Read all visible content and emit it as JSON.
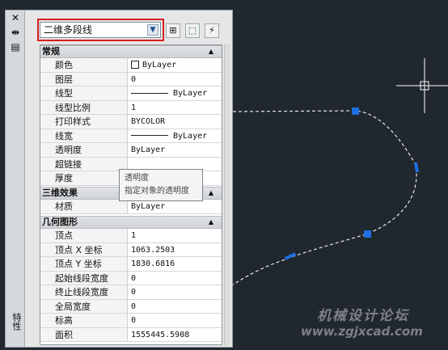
{
  "object_selector": {
    "value": "二维多段线",
    "arrow_icon": "chevron-down-icon"
  },
  "titlebar": {
    "close_glyph": "✕",
    "autohide_glyph": "⇹",
    "menu_glyph": "▤",
    "vertical_title": "特性"
  },
  "toolbar": [
    {
      "name": "toggle-pickadd-button",
      "icon": "pickadd-icon",
      "glyph": "⊞"
    },
    {
      "name": "select-objects-button",
      "icon": "select-objects-icon",
      "glyph": "⬚"
    },
    {
      "name": "quick-select-button",
      "icon": "quick-select-icon",
      "glyph": "⚡"
    }
  ],
  "sections": {
    "general": "常规",
    "3d_effects": "三维效果",
    "geometry": "几何图形"
  },
  "general_rows": [
    {
      "label": "颜色",
      "value": "ByLayer",
      "kind": "color"
    },
    {
      "label": "图层",
      "value": "0"
    },
    {
      "label": "线型",
      "value": "ByLayer",
      "kind": "line"
    },
    {
      "label": "线型比例",
      "value": "1"
    },
    {
      "label": "打印样式",
      "value": "BYCOLOR"
    },
    {
      "label": "线宽",
      "value": "ByLayer",
      "kind": "line"
    },
    {
      "label": "透明度",
      "value": "ByLayer"
    },
    {
      "label": "超链接",
      "value": ""
    },
    {
      "label": "厚度",
      "value": ""
    }
  ],
  "effects_rows": [
    {
      "label": "材质",
      "value": "ByLayer"
    }
  ],
  "geometry_rows": [
    {
      "label": "顶点",
      "value": "1"
    },
    {
      "label": "顶点 X 坐标",
      "value": "1063.2503"
    },
    {
      "label": "顶点 Y 坐标",
      "value": "1830.6816"
    },
    {
      "label": "起始线段宽度",
      "value": "0"
    },
    {
      "label": "终止线段宽度",
      "value": "0"
    },
    {
      "label": "全局宽度",
      "value": "0"
    },
    {
      "label": "标高",
      "value": "0"
    },
    {
      "label": "面积",
      "value": "1555445.5908"
    }
  ],
  "tooltip": {
    "title": "透明度",
    "description": "指定对象的透明度"
  },
  "watermark": {
    "title": "机械设计论坛",
    "url": "www.zgjxcad.com"
  },
  "colors": {
    "canvas": "#20272f",
    "highlight": "#d81e1e",
    "grip": "#1e6fe0"
  }
}
